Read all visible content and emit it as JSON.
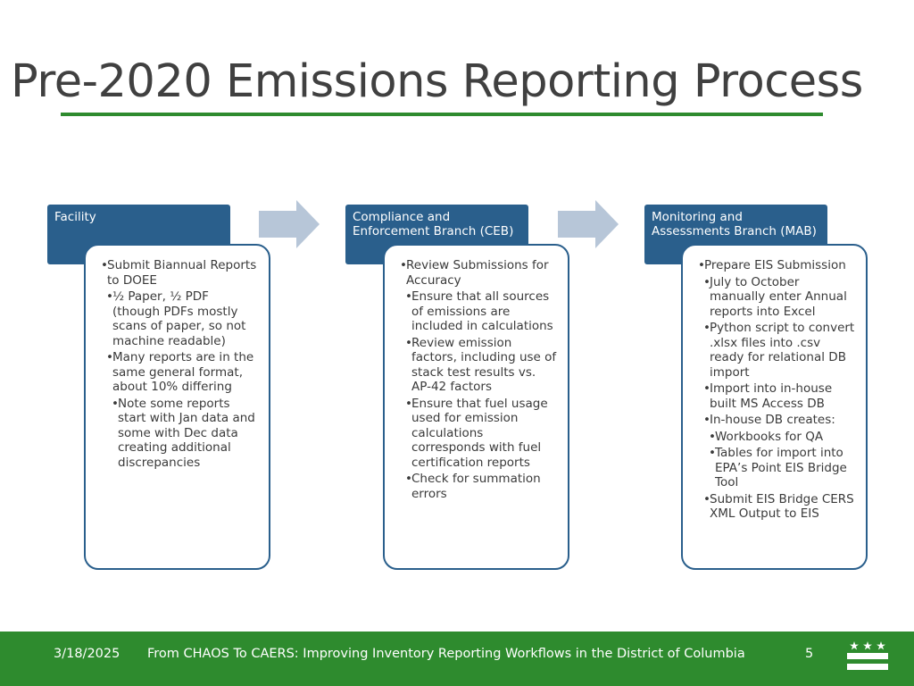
{
  "slide": {
    "title": "Pre-2020 Emissions Reporting Process"
  },
  "stages": [
    {
      "header": "Facility",
      "items": [
        {
          "text": "Submit Biannual Reports to DOEE",
          "level": 1
        },
        {
          "text": "½ Paper, ½ PDF (though PDFs mostly scans of paper, so not machine readable)",
          "level": 2
        },
        {
          "text": "Many reports are in the same general format, about 10% differing",
          "level": 2
        },
        {
          "text": "Note some reports start with Jan data and some with Dec data creating additional discrepancies",
          "level": 3
        }
      ]
    },
    {
      "header": "Compliance and Enforcement Branch (CEB)",
      "items": [
        {
          "text": "Review Submissions for Accuracy",
          "level": 1
        },
        {
          "text": "Ensure that all sources of emissions are included in calculations",
          "level": 2
        },
        {
          "text": "Review emission factors, including use of stack test results vs. AP-42 factors",
          "level": 2
        },
        {
          "text": "Ensure that fuel usage used for emission calculations corresponds with fuel certification reports",
          "level": 2
        },
        {
          "text": "Check for summation errors",
          "level": 2
        }
      ]
    },
    {
      "header": "Monitoring and Assessments Branch (MAB)",
      "items": [
        {
          "text": "Prepare EIS Submission",
          "level": 1
        },
        {
          "text": "July to October manually enter Annual reports into Excel",
          "level": 2
        },
        {
          "text": "Python script to convert .xlsx files into .csv ready for relational DB import",
          "level": 2
        },
        {
          "text": "Import into in-house built MS Access DB",
          "level": 2
        },
        {
          "text": "In-house DB creates:",
          "level": 2
        },
        {
          "text": "Workbooks for QA",
          "level": 3
        },
        {
          "text": "Tables for import into EPA’s Point EIS Bridge Tool",
          "level": 3
        },
        {
          "text": "Submit EIS Bridge CERS XML Output to EIS",
          "level": 2
        }
      ]
    }
  ],
  "footer": {
    "date": "3/18/2025",
    "caption": "From CHAOS To CAERS: Improving Inventory Reporting Workflows in the District of Columbia",
    "page_number": "5"
  },
  "colors": {
    "header_fill": "#2a5f8c",
    "arrow_fill": "#b7c6d8",
    "accent_green": "#2e8b2e"
  },
  "icons": {
    "flag": "dc-flag-icon",
    "arrow": "right-arrow-icon"
  }
}
